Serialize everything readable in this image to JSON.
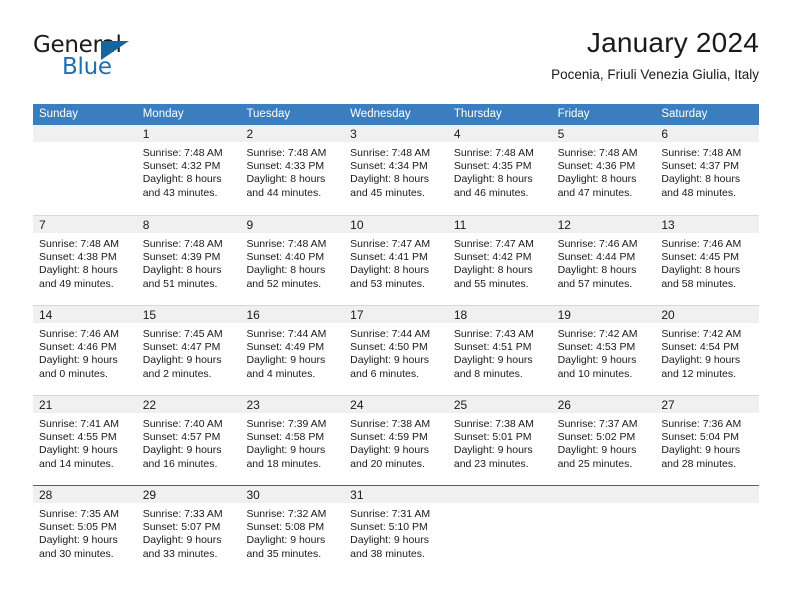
{
  "brand": {
    "name_line1": "General",
    "name_line2": "Blue",
    "triangle_icon": "triangle-icon",
    "color_black": "#1b1b1b",
    "color_blue": "#1f6fb5"
  },
  "header": {
    "title": "January 2024",
    "subtitle": "Pocenia, Friuli Venezia Giulia, Italy"
  },
  "theme": {
    "header_bar": "#3a7ebf",
    "day_band": "#f0f0f0",
    "row_divider": "#d8d8d8",
    "last_row_divider": "#2e6da4"
  },
  "weekdays": [
    "Sunday",
    "Monday",
    "Tuesday",
    "Wednesday",
    "Thursday",
    "Friday",
    "Saturday"
  ],
  "weeks": [
    [
      {
        "day": "",
        "sunrise": "",
        "sunset": "",
        "daylight1": "",
        "daylight2": "",
        "empty": true
      },
      {
        "day": "1",
        "sunrise": "Sunrise: 7:48 AM",
        "sunset": "Sunset: 4:32 PM",
        "daylight1": "Daylight: 8 hours",
        "daylight2": "and 43 minutes.",
        "empty": false
      },
      {
        "day": "2",
        "sunrise": "Sunrise: 7:48 AM",
        "sunset": "Sunset: 4:33 PM",
        "daylight1": "Daylight: 8 hours",
        "daylight2": "and 44 minutes.",
        "empty": false
      },
      {
        "day": "3",
        "sunrise": "Sunrise: 7:48 AM",
        "sunset": "Sunset: 4:34 PM",
        "daylight1": "Daylight: 8 hours",
        "daylight2": "and 45 minutes.",
        "empty": false
      },
      {
        "day": "4",
        "sunrise": "Sunrise: 7:48 AM",
        "sunset": "Sunset: 4:35 PM",
        "daylight1": "Daylight: 8 hours",
        "daylight2": "and 46 minutes.",
        "empty": false
      },
      {
        "day": "5",
        "sunrise": "Sunrise: 7:48 AM",
        "sunset": "Sunset: 4:36 PM",
        "daylight1": "Daylight: 8 hours",
        "daylight2": "and 47 minutes.",
        "empty": false
      },
      {
        "day": "6",
        "sunrise": "Sunrise: 7:48 AM",
        "sunset": "Sunset: 4:37 PM",
        "daylight1": "Daylight: 8 hours",
        "daylight2": "and 48 minutes.",
        "empty": false
      }
    ],
    [
      {
        "day": "7",
        "sunrise": "Sunrise: 7:48 AM",
        "sunset": "Sunset: 4:38 PM",
        "daylight1": "Daylight: 8 hours",
        "daylight2": "and 49 minutes.",
        "empty": false
      },
      {
        "day": "8",
        "sunrise": "Sunrise: 7:48 AM",
        "sunset": "Sunset: 4:39 PM",
        "daylight1": "Daylight: 8 hours",
        "daylight2": "and 51 minutes.",
        "empty": false
      },
      {
        "day": "9",
        "sunrise": "Sunrise: 7:48 AM",
        "sunset": "Sunset: 4:40 PM",
        "daylight1": "Daylight: 8 hours",
        "daylight2": "and 52 minutes.",
        "empty": false
      },
      {
        "day": "10",
        "sunrise": "Sunrise: 7:47 AM",
        "sunset": "Sunset: 4:41 PM",
        "daylight1": "Daylight: 8 hours",
        "daylight2": "and 53 minutes.",
        "empty": false
      },
      {
        "day": "11",
        "sunrise": "Sunrise: 7:47 AM",
        "sunset": "Sunset: 4:42 PM",
        "daylight1": "Daylight: 8 hours",
        "daylight2": "and 55 minutes.",
        "empty": false
      },
      {
        "day": "12",
        "sunrise": "Sunrise: 7:46 AM",
        "sunset": "Sunset: 4:44 PM",
        "daylight1": "Daylight: 8 hours",
        "daylight2": "and 57 minutes.",
        "empty": false
      },
      {
        "day": "13",
        "sunrise": "Sunrise: 7:46 AM",
        "sunset": "Sunset: 4:45 PM",
        "daylight1": "Daylight: 8 hours",
        "daylight2": "and 58 minutes.",
        "empty": false
      }
    ],
    [
      {
        "day": "14",
        "sunrise": "Sunrise: 7:46 AM",
        "sunset": "Sunset: 4:46 PM",
        "daylight1": "Daylight: 9 hours",
        "daylight2": "and 0 minutes.",
        "empty": false
      },
      {
        "day": "15",
        "sunrise": "Sunrise: 7:45 AM",
        "sunset": "Sunset: 4:47 PM",
        "daylight1": "Daylight: 9 hours",
        "daylight2": "and 2 minutes.",
        "empty": false
      },
      {
        "day": "16",
        "sunrise": "Sunrise: 7:44 AM",
        "sunset": "Sunset: 4:49 PM",
        "daylight1": "Daylight: 9 hours",
        "daylight2": "and 4 minutes.",
        "empty": false
      },
      {
        "day": "17",
        "sunrise": "Sunrise: 7:44 AM",
        "sunset": "Sunset: 4:50 PM",
        "daylight1": "Daylight: 9 hours",
        "daylight2": "and 6 minutes.",
        "empty": false
      },
      {
        "day": "18",
        "sunrise": "Sunrise: 7:43 AM",
        "sunset": "Sunset: 4:51 PM",
        "daylight1": "Daylight: 9 hours",
        "daylight2": "and 8 minutes.",
        "empty": false
      },
      {
        "day": "19",
        "sunrise": "Sunrise: 7:42 AM",
        "sunset": "Sunset: 4:53 PM",
        "daylight1": "Daylight: 9 hours",
        "daylight2": "and 10 minutes.",
        "empty": false
      },
      {
        "day": "20",
        "sunrise": "Sunrise: 7:42 AM",
        "sunset": "Sunset: 4:54 PM",
        "daylight1": "Daylight: 9 hours",
        "daylight2": "and 12 minutes.",
        "empty": false
      }
    ],
    [
      {
        "day": "21",
        "sunrise": "Sunrise: 7:41 AM",
        "sunset": "Sunset: 4:55 PM",
        "daylight1": "Daylight: 9 hours",
        "daylight2": "and 14 minutes.",
        "empty": false
      },
      {
        "day": "22",
        "sunrise": "Sunrise: 7:40 AM",
        "sunset": "Sunset: 4:57 PM",
        "daylight1": "Daylight: 9 hours",
        "daylight2": "and 16 minutes.",
        "empty": false
      },
      {
        "day": "23",
        "sunrise": "Sunrise: 7:39 AM",
        "sunset": "Sunset: 4:58 PM",
        "daylight1": "Daylight: 9 hours",
        "daylight2": "and 18 minutes.",
        "empty": false
      },
      {
        "day": "24",
        "sunrise": "Sunrise: 7:38 AM",
        "sunset": "Sunset: 4:59 PM",
        "daylight1": "Daylight: 9 hours",
        "daylight2": "and 20 minutes.",
        "empty": false
      },
      {
        "day": "25",
        "sunrise": "Sunrise: 7:38 AM",
        "sunset": "Sunset: 5:01 PM",
        "daylight1": "Daylight: 9 hours",
        "daylight2": "and 23 minutes.",
        "empty": false
      },
      {
        "day": "26",
        "sunrise": "Sunrise: 7:37 AM",
        "sunset": "Sunset: 5:02 PM",
        "daylight1": "Daylight: 9 hours",
        "daylight2": "and 25 minutes.",
        "empty": false
      },
      {
        "day": "27",
        "sunrise": "Sunrise: 7:36 AM",
        "sunset": "Sunset: 5:04 PM",
        "daylight1": "Daylight: 9 hours",
        "daylight2": "and 28 minutes.",
        "empty": false
      }
    ],
    [
      {
        "day": "28",
        "sunrise": "Sunrise: 7:35 AM",
        "sunset": "Sunset: 5:05 PM",
        "daylight1": "Daylight: 9 hours",
        "daylight2": "and 30 minutes.",
        "empty": false
      },
      {
        "day": "29",
        "sunrise": "Sunrise: 7:33 AM",
        "sunset": "Sunset: 5:07 PM",
        "daylight1": "Daylight: 9 hours",
        "daylight2": "and 33 minutes.",
        "empty": false
      },
      {
        "day": "30",
        "sunrise": "Sunrise: 7:32 AM",
        "sunset": "Sunset: 5:08 PM",
        "daylight1": "Daylight: 9 hours",
        "daylight2": "and 35 minutes.",
        "empty": false
      },
      {
        "day": "31",
        "sunrise": "Sunrise: 7:31 AM",
        "sunset": "Sunset: 5:10 PM",
        "daylight1": "Daylight: 9 hours",
        "daylight2": "and 38 minutes.",
        "empty": false
      },
      {
        "day": "",
        "sunrise": "",
        "sunset": "",
        "daylight1": "",
        "daylight2": "",
        "empty": true
      },
      {
        "day": "",
        "sunrise": "",
        "sunset": "",
        "daylight1": "",
        "daylight2": "",
        "empty": true
      },
      {
        "day": "",
        "sunrise": "",
        "sunset": "",
        "daylight1": "",
        "daylight2": "",
        "empty": true
      }
    ]
  ]
}
